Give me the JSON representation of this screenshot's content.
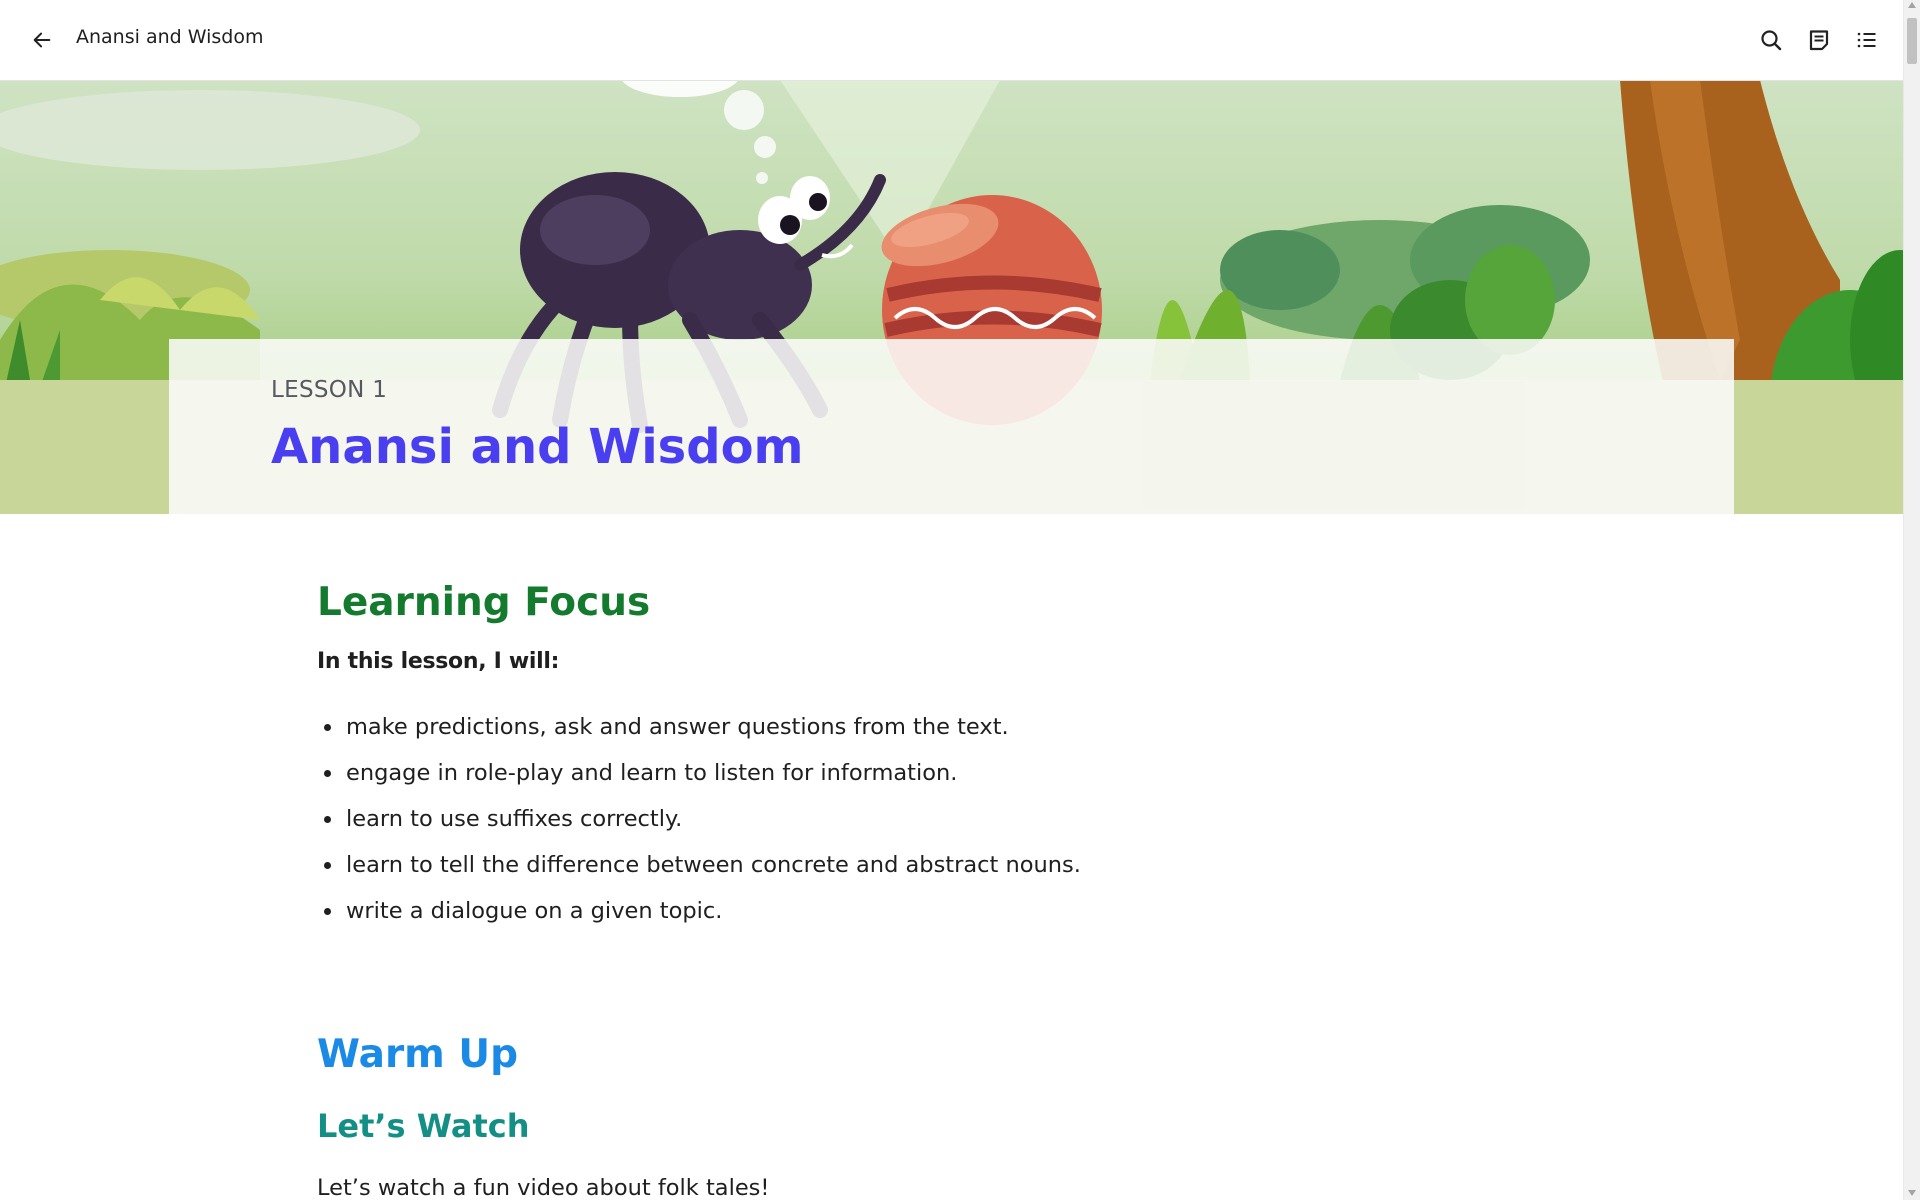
{
  "header": {
    "title": "Anansi and Wisdom",
    "back_icon": "arrow-left-icon",
    "actions": [
      "search-icon",
      "notes-icon",
      "table-of-contents-icon"
    ]
  },
  "hero": {
    "lesson_label": "LESSON 1",
    "lesson_title": "Anansi and Wisdom"
  },
  "learning_focus": {
    "heading": "Learning Focus",
    "intro": "In this lesson, I will:",
    "items": [
      "make predictions, ask and answer questions from the text.",
      "engage in role-play and learn to listen for information.",
      "learn to use suffixes correctly.",
      "learn to tell the difference between concrete and abstract nouns.",
      "write a dialogue on a given topic."
    ]
  },
  "warm_up": {
    "heading": "Warm Up",
    "subheading": "Let’s Watch",
    "text": "Let’s watch a fun video about folk tales!"
  },
  "colors": {
    "lesson_title": "#4a3ff0",
    "focus_heading": "#147a2e",
    "warm_heading": "#1a8ae6",
    "watch_heading": "#148f86"
  }
}
